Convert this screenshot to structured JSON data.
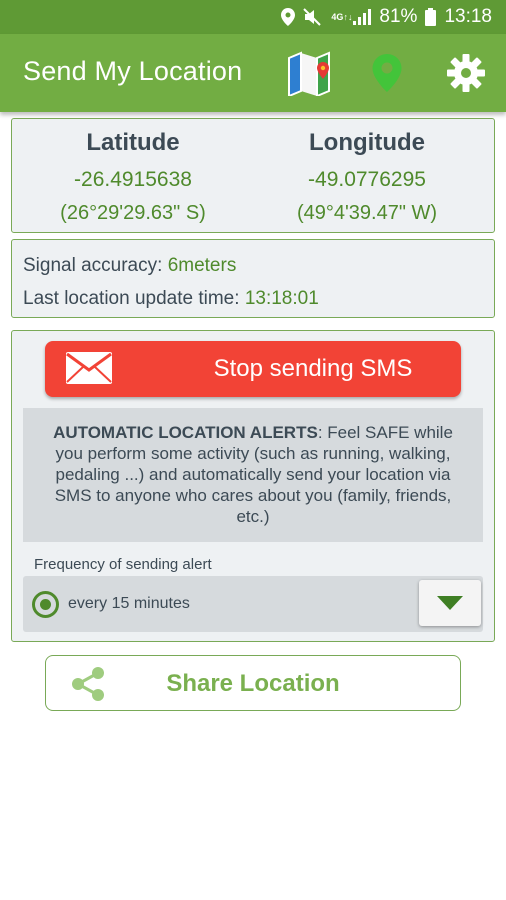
{
  "status_bar": {
    "net_top": "4G",
    "net_bottom": "↑↓",
    "battery": "81%",
    "time": "13:18"
  },
  "app_bar": {
    "title": "Send My Location",
    "icons": [
      "map-icon",
      "location-pin-icon",
      "settings-gear-icon"
    ]
  },
  "coordinates": {
    "latitude_label": "Latitude",
    "latitude_decimal": "-26.4915638",
    "latitude_dms": "(26°29'29.63\" S)",
    "longitude_label": "Longitude",
    "longitude_decimal": "-49.0776295",
    "longitude_dms": "(49°4'39.47\" W)"
  },
  "info": {
    "accuracy_label": "Signal accuracy: ",
    "accuracy_value": "6meters",
    "update_label": "Last location update time: ",
    "update_value": "13:18:01"
  },
  "sms": {
    "stop_label": "Stop sending SMS",
    "alert_bold": "AUTOMATIC LOCATION ALERTS",
    "alert_text": ": Feel SAFE while you perform some activity (such as running, walking, pedaling ...) and automatically send your location via SMS to anyone who cares about you (family, friends, etc.)",
    "frequency_label": "Frequency of sending alert",
    "frequency_value": "every 15 minutes"
  },
  "share": {
    "label": "Share Location"
  },
  "colors": {
    "status_bar": "#5f9a35",
    "app_bar": "#72ad43",
    "accent_green": "#4f8a2c",
    "stop_red": "#f24336",
    "card_bg": "#eef1f3",
    "panel_bg": "#d6dadd"
  }
}
